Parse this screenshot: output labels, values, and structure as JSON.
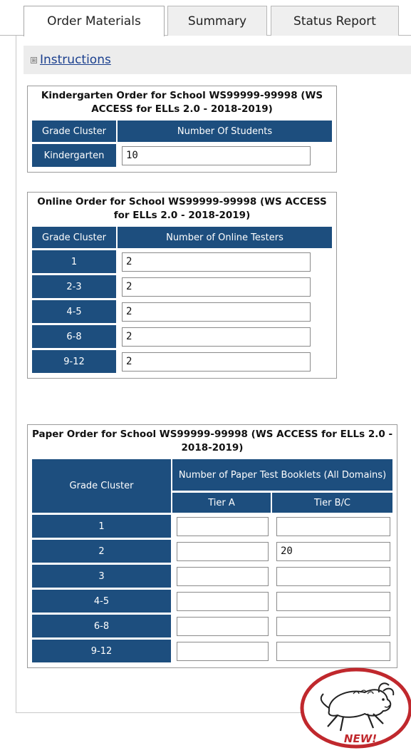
{
  "tabs": [
    {
      "label": "Order Materials",
      "active": true
    },
    {
      "label": "Summary",
      "active": false
    },
    {
      "label": "Status Report",
      "active": false
    }
  ],
  "instructions": {
    "toggle": "⊞",
    "label": "Instructions"
  },
  "kindergarten": {
    "title": "Kindergarten Order for School WS99999-99998 (WS ACCESS for ELLs 2.0 - 2018-2019)",
    "col_grade": "Grade Cluster",
    "col_count": "Number Of Students",
    "rows": [
      {
        "grade": "Kindergarten",
        "value": "10"
      }
    ]
  },
  "online": {
    "title": "Online Order for School WS99999-99998 (WS ACCESS for ELLs 2.0 - 2018-2019)",
    "col_grade": "Grade Cluster",
    "col_count": "Number of Online Testers",
    "rows": [
      {
        "grade": "1",
        "value": "2"
      },
      {
        "grade": "2-3",
        "value": "2"
      },
      {
        "grade": "4-5",
        "value": "2"
      },
      {
        "grade": "6-8",
        "value": "2"
      },
      {
        "grade": "9-12",
        "value": "2"
      }
    ]
  },
  "paper": {
    "title": "Paper Order for School WS99999-99998 (WS ACCESS for ELLs 2.0 - 2018-2019)",
    "col_grade": "Grade Cluster",
    "col_group": "Number of Paper Test Booklets (All Domains)",
    "col_tier_a": "Tier A",
    "col_tier_bc": "Tier B/C",
    "rows": [
      {
        "grade": "1",
        "tier_a": "",
        "tier_bc": ""
      },
      {
        "grade": "2",
        "tier_a": "",
        "tier_bc": "20"
      },
      {
        "grade": "3",
        "tier_a": "",
        "tier_bc": ""
      },
      {
        "grade": "4-5",
        "tier_a": "",
        "tier_bc": ""
      },
      {
        "grade": "6-8",
        "tier_a": "",
        "tier_bc": ""
      },
      {
        "grade": "9-12",
        "tier_a": "",
        "tier_bc": ""
      }
    ]
  },
  "badge": {
    "text": "NEW!",
    "icon": "running-buffalo-icon"
  },
  "colors": {
    "header_blue": "#1d4e7e",
    "link_blue": "#1a3f8e",
    "badge_red": "#c0282d"
  }
}
